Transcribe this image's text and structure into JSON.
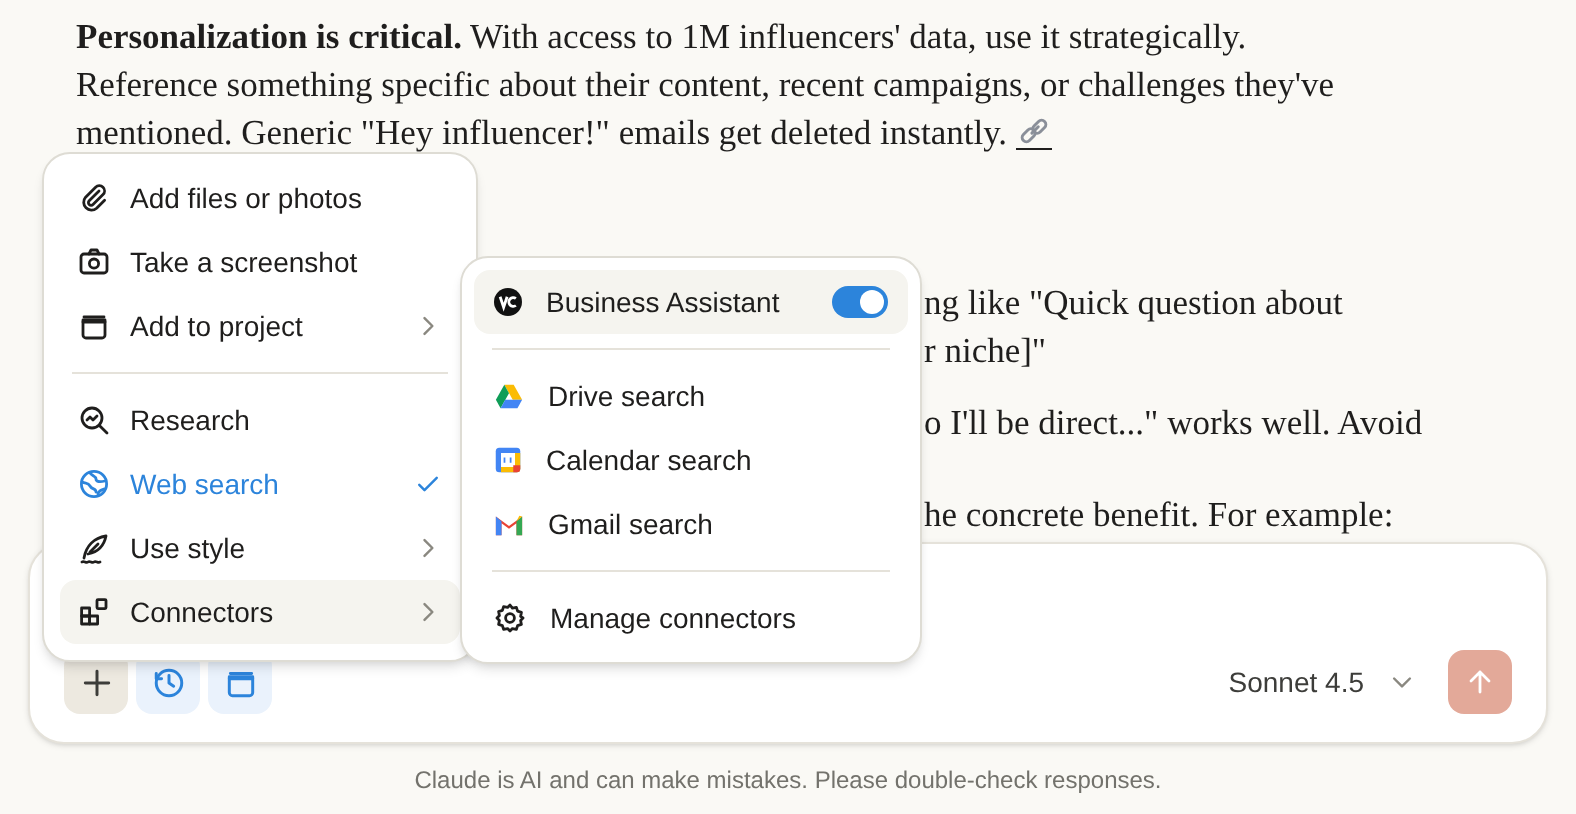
{
  "message": {
    "paragraph": "**Personalization is critical.** With access to 1M influencers' data, use it strategically. Reference something specific about their content, recent campaigns, or challenges they've mentioned. Generic \"Hey influencer!\" emails get deleted instantly.",
    "fragments": [
      "ng like \"Quick question about",
      "r niche]\"",
      "o I'll be direct...\" works well. Avoid",
      "he concrete benefit. For example:"
    ]
  },
  "attach_menu": {
    "groups": [
      [
        {
          "label": "Add files or photos",
          "has_submenu": false,
          "checked": false,
          "selected": false
        },
        {
          "label": "Take a screenshot",
          "has_submenu": false,
          "checked": false,
          "selected": false
        },
        {
          "label": "Add to project",
          "has_submenu": true,
          "checked": false,
          "selected": false
        }
      ],
      [
        {
          "label": "Research",
          "has_submenu": false,
          "checked": false,
          "selected": false
        },
        {
          "label": "Web search",
          "has_submenu": false,
          "checked": true,
          "selected": false
        },
        {
          "label": "Use style",
          "has_submenu": true,
          "checked": false,
          "selected": false
        },
        {
          "label": "Connectors",
          "has_submenu": true,
          "checked": false,
          "selected": true
        }
      ]
    ]
  },
  "connectors_menu": {
    "groups": [
      [
        {
          "kind": "toggle",
          "label": "Business Assistant",
          "on": true,
          "selected": true
        }
      ],
      [
        {
          "kind": "connector",
          "label": "Drive search",
          "selected": false
        },
        {
          "kind": "connector",
          "label": "Calendar search",
          "selected": false
        },
        {
          "kind": "connector",
          "label": "Gmail search",
          "selected": false
        }
      ],
      [
        {
          "kind": "action",
          "label": "Manage connectors",
          "selected": false
        }
      ]
    ]
  },
  "composer": {
    "tools": [
      {
        "active": false
      },
      {
        "active": true
      },
      {
        "active": true
      }
    ],
    "model": "Sonnet 4.5",
    "send_disabled": true
  },
  "disclaimer": "Claude is AI and can make mistakes. Please double-check responses."
}
